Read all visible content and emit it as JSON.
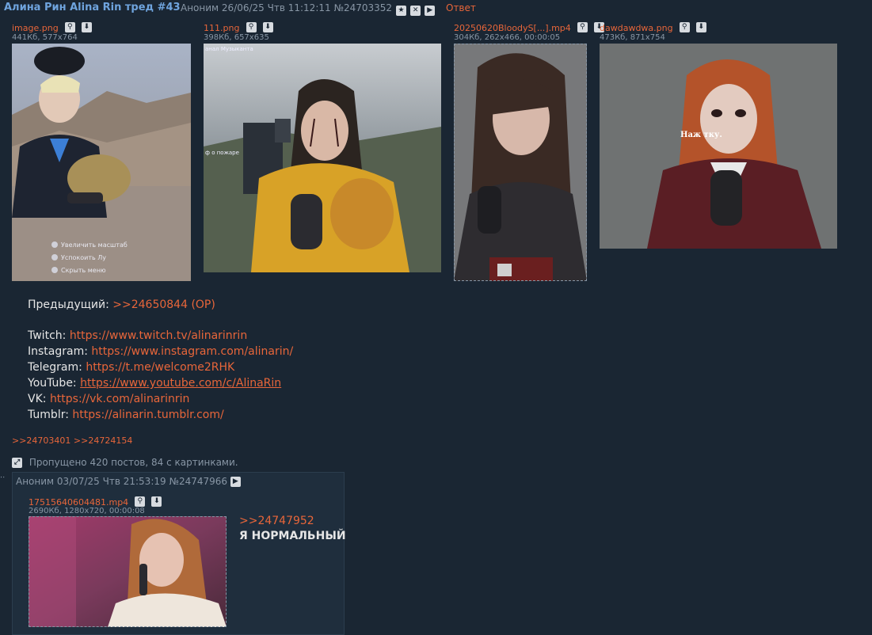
{
  "op": {
    "title": "Алина Рин Alina Rin тред #43",
    "author": "Аноним",
    "date": "26/06/25 Чтв 11:12:11",
    "post_num": "№24703352",
    "reply_label": "Ответ",
    "files": [
      {
        "name": "image.png",
        "info": "441Кб, 577x764",
        "type": "image"
      },
      {
        "name": "111.png",
        "info": "398Кб, 657x635",
        "type": "image"
      },
      {
        "name": "20250620BloodyS[...].mp4",
        "info": "304Кб, 262x466, 00:00:05",
        "type": "video"
      },
      {
        "name": "dawdawdwa.png",
        "info": "473Кб, 871x754",
        "type": "image"
      }
    ],
    "thumb1_overlay": {
      "zoom": "Увеличить масштаб",
      "calm": "Успокоить Лу",
      "hide": "Скрыть меню"
    },
    "thumb2_overlay": "анал Музыканта",
    "thumb2_side": "ф о пожаре",
    "thumb4_overlay": "Наж           тку.",
    "prev_label": "Предыдущий:",
    "prev_link": ">>24650844 (OP)",
    "links": [
      {
        "label": "Twitch:",
        "url": "https://www.twitch.tv/alinarinrin"
      },
      {
        "label": "Instagram:",
        "url": "https://www.instagram.com/alinarin/"
      },
      {
        "label": "Telegram:",
        "url": "https://t.me/welcome2RHK"
      },
      {
        "label": "YouTube:",
        "url": "https://www.youtube.com/c/AlinaRin"
      },
      {
        "label": "VK:",
        "url": "https://vk.com/alinarinrin"
      },
      {
        "label": "Tumblr:",
        "url": "https://alinarin.tumblr.com/"
      }
    ],
    "backlinks": ">>24703401 >>24724154"
  },
  "omitted": "Пропущено 420 постов, 84 с картинками.",
  "reply": {
    "author": "Аноним",
    "date": "03/07/25 Чтв 21:53:19",
    "post_num": "№24747966",
    "file": {
      "name": "17515640604481.mp4",
      "info": "2690Кб, 1280x720, 00:00:08"
    },
    "quote": ">>24747952",
    "text": "Я НОРМАЛЬНЫЙ"
  },
  "colors": {
    "background": "#1a2633",
    "title": "#6fa4de",
    "link": "#e8663a",
    "meta": "#8896a5"
  }
}
